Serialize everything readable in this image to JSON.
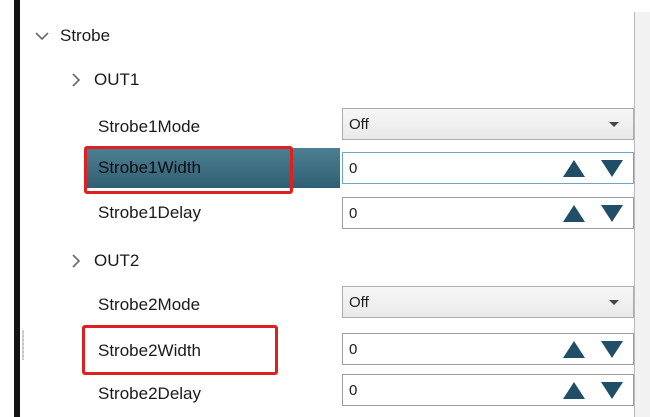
{
  "tree": {
    "group_label": "Strobe",
    "sections": [
      {
        "label": "OUT1",
        "props": [
          {
            "label": "Strobe1Mode",
            "value": "Off",
            "kind": "dropdown"
          },
          {
            "label": "Strobe1Width",
            "value": "0",
            "kind": "spinner",
            "selected": true,
            "highlighted": true
          },
          {
            "label": "Strobe1Delay",
            "value": "0",
            "kind": "spinner"
          }
        ]
      },
      {
        "label": "OUT2",
        "props": [
          {
            "label": "Strobe2Mode",
            "value": "Off",
            "kind": "dropdown"
          },
          {
            "label": "Strobe2Width",
            "value": "0",
            "kind": "spinner",
            "highlighted": true
          },
          {
            "label": "Strobe2Delay",
            "value": "0",
            "kind": "spinner"
          }
        ]
      }
    ]
  },
  "colors": {
    "highlight": "#e02020",
    "selection": "#3d6f82",
    "spinner_arrow": "#1f4e66"
  },
  "icons": {
    "group_toggle": "chevron-down-icon",
    "section_toggle": "chevron-right-icon",
    "dropdown": "caret-down-icon",
    "increment": "triangle-up-icon",
    "decrement": "triangle-down-icon"
  }
}
